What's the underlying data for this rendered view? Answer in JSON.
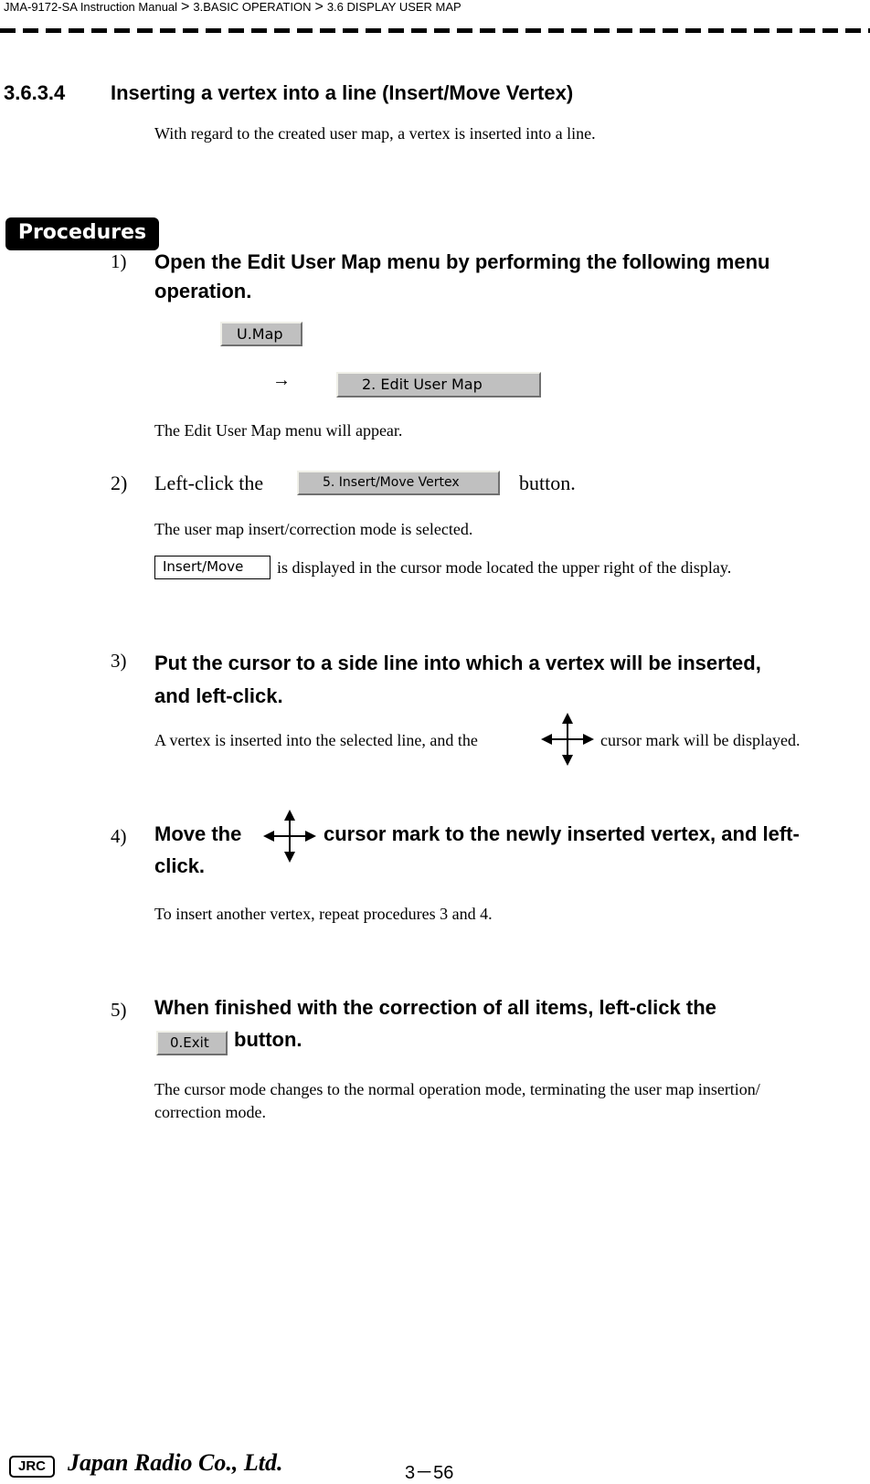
{
  "header": {
    "breadcrumb": [
      "JMA-9172-SA Instruction Manual",
      "3.BASIC OPERATION",
      "3.6  DISPLAY USER MAP"
    ],
    "separator": ">"
  },
  "section": {
    "number": "3.6.3.4",
    "title": "Inserting a vertex into a line (Insert/Move Vertex)",
    "intro": "With regard to the created user map, a vertex is inserted into a line."
  },
  "procedures_label": "Procedures",
  "steps": [
    {
      "number": "1)",
      "heading_line1": "Open the Edit User Map menu by performing the following menu",
      "heading_line2": "operation.",
      "menu_button_1": "U.Map",
      "arrow": "→",
      "menu_button_2": "2. Edit User Map",
      "result": "The Edit User Map menu will appear."
    },
    {
      "number": "2)",
      "text_before": "Left-click the",
      "button": "5. Insert/Move Vertex",
      "text_after": "button.",
      "result": "The user map insert/correction mode is selected.",
      "mode_box": "Insert/Move",
      "mode_text": "is displayed in the cursor mode located the upper right of the display."
    },
    {
      "number": "3)",
      "heading_line1": "Put the cursor to a side line into which a vertex will be inserted,",
      "heading_line2": "and left-click.",
      "result_before": "A vertex is inserted into the selected line, and the",
      "result_after": "cursor mark will be displayed.",
      "icon": "four-way-arrow-cursor-icon"
    },
    {
      "number": "4)",
      "heading_before": "Move the",
      "heading_after": "cursor mark to the newly inserted vertex, and left-",
      "heading_line2": "click.",
      "result": "To insert another vertex, repeat procedures 3 and 4.",
      "icon": "four-way-arrow-cursor-icon"
    },
    {
      "number": "5)",
      "heading_line1": "When finished with the correction of all items, left-click the",
      "button": "0.Exit",
      "heading_after": "button.",
      "result_line1": "The cursor mode changes to the normal operation mode, terminating the user map insertion/",
      "result_line2": "correction mode."
    }
  ],
  "footer": {
    "logo": "JRC",
    "company": "Japan Radio Co., Ltd.",
    "page": "3－56"
  }
}
